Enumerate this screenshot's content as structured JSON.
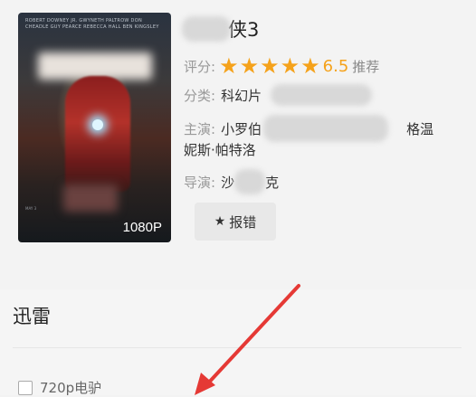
{
  "movie": {
    "title_suffix": "侠3",
    "poster_quality": "1080P",
    "poster_credits": "ROBERT DOWNEY JR.  GWYNETH PALTROW  DON CHEADLE  GUY PEARCE  REBECCA HALL  BEN KINGSLEY",
    "poster_date": "MAY 3"
  },
  "rating": {
    "label": "评分:",
    "stars": 5,
    "score": "6.5",
    "recommend": "推荐"
  },
  "genre": {
    "label": "分类:",
    "value": "科幻片"
  },
  "cast": {
    "label": "主演:",
    "value_start": "小罗伯",
    "value_end": "格温",
    "line2": "妮斯·帕特洛"
  },
  "director": {
    "label": "导演:",
    "value_start": "沙",
    "value_end": "克"
  },
  "report_button": {
    "label": "报错",
    "icon": "star-icon"
  },
  "download": {
    "section_title": "迅雷",
    "items": [
      {
        "label": "720p电驴",
        "checked": false
      }
    ]
  },
  "colors": {
    "accent_star": "#f5a21b",
    "arrow": "#e53935"
  }
}
